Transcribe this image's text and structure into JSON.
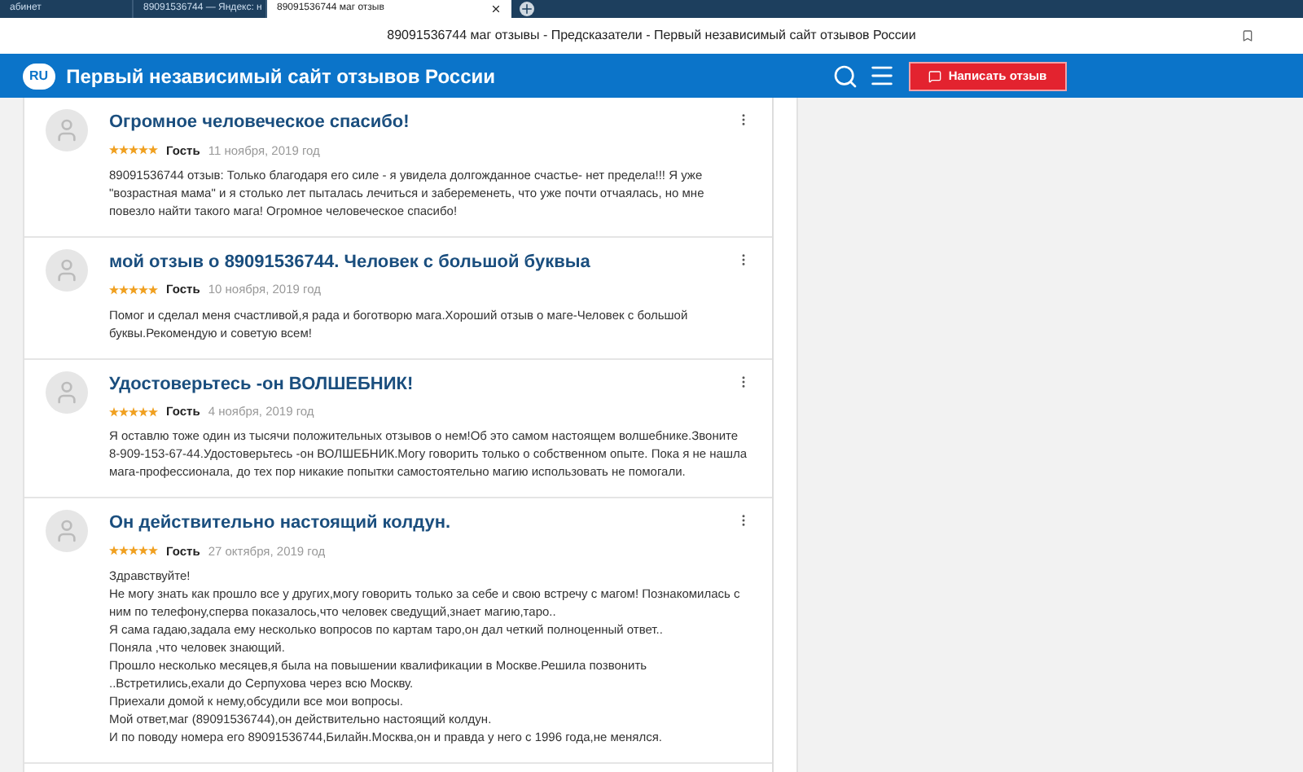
{
  "browser": {
    "tabs": [
      {
        "label": "абинет",
        "selected": false
      },
      {
        "label": "89091536744 — Яндекс: н",
        "selected": false
      },
      {
        "label": "89091536744 маг отзыв",
        "selected": true
      }
    ],
    "page_title": "89091536744 маг отзывы - Предсказатели - Первый независимый сайт отзывов России"
  },
  "site": {
    "logo": "RU",
    "title": "Первый независимый сайт отзывов России",
    "write_button": "Написать отзыв"
  },
  "reviews": [
    {
      "title": "Огромное человеческое спасибо!",
      "stars": 5,
      "author": "Гость",
      "date": "11 ноября, 2019 год",
      "body": [
        "89091536744 отзыв: Только благодаря его силе - я увидела долгожданное счастье- нет предела!!! Я уже \"возрастная мама\" и я столько лет пыталась лечиться и забеременеть, что уже почти отчаялась, но мне повезло найти такого мага! Огромное человеческое спасибо!"
      ]
    },
    {
      "title": "мой отзыв о 89091536744. Человек с большой буквыа",
      "stars": 5,
      "author": "Гость",
      "date": "10 ноября, 2019 год",
      "body": [
        "Помог и сделал меня счастливой,я рада и боготворю мага.Хороший отзыв о маге-Человек с большой буквы.Рекомендую и советую всем!"
      ]
    },
    {
      "title": "Удостоверьтесь -он ВОЛШЕБНИК!",
      "stars": 5,
      "author": "Гость",
      "date": "4 ноября, 2019 год",
      "body": [
        "Я оставлю тоже один из тысячи положительных отзывов о нем!Об это самом настоящем волшебнике.Звоните 8-909-153-67-44.Удостоверьтесь -он ВОЛШЕБНИК.Могу говорить только о собственном опыте. Пока я не нашла мага-профессионала, до тех пор никакие попытки самостоятельно магию использовать не помогали."
      ]
    },
    {
      "title": "Он действительно настоящий колдун.",
      "stars": 5,
      "author": "Гость",
      "date": "27 октября, 2019 год",
      "body": [
        "Здравствуйте!",
        "Не могу знать как прошло все у других,могу говорить только за себе и свою встречу с магом! Познакомилась с ним по телефону,сперва показалось,что человек сведущий,знает магию,таро..",
        "Я сама гадаю,задала ему несколько вопросов по картам таро,он дал четкий полноценный ответ..",
        "Поняла ,что человек знающий.",
        "Прошло несколько месяцев,я была на повышении квалификации в Москве.Решила позвонить",
        "..Встретились,ехали до Серпухова через всю Москву.",
        "Приехали домой к нему,обсудили все мои вопросы.",
        "Мой ответ,маг (89091536744),он действительно настоящий колдун.",
        "И по поводу номера его 89091536744,Билайн.Москва,он и правда у него с 1996 года,не менялся."
      ]
    }
  ]
}
